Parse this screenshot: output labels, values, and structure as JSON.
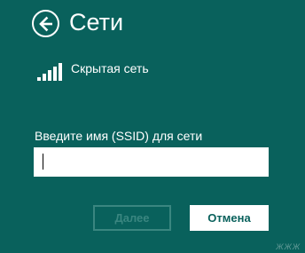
{
  "header": {
    "title": "Сети",
    "back_icon": "back-arrow-icon"
  },
  "network": {
    "name": "Скрытая сеть",
    "signal_icon": "wifi-signal-icon",
    "signal_bars": 5
  },
  "form": {
    "ssid_label": "Введите имя (SSID) для сети",
    "ssid_value": ""
  },
  "buttons": {
    "next_label": "Далее",
    "cancel_label": "Отмена"
  },
  "watermark": "ЖЖЖ",
  "colors": {
    "background": "#09615c",
    "text": "#ffffff",
    "disabled": "#3a8680"
  }
}
